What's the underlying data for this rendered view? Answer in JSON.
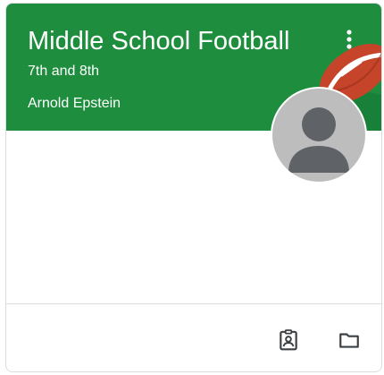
{
  "card": {
    "title": "Middle School Football",
    "section": "7th and 8th",
    "teacher": "Arnold Epstein",
    "header_color": "#1e8e3e"
  },
  "icons": {
    "more": "more-vert-icon",
    "avatar": "person-avatar-icon",
    "portfolio": "assignment-ind-icon",
    "folder": "folder-icon",
    "decoration": "football-illustration"
  }
}
